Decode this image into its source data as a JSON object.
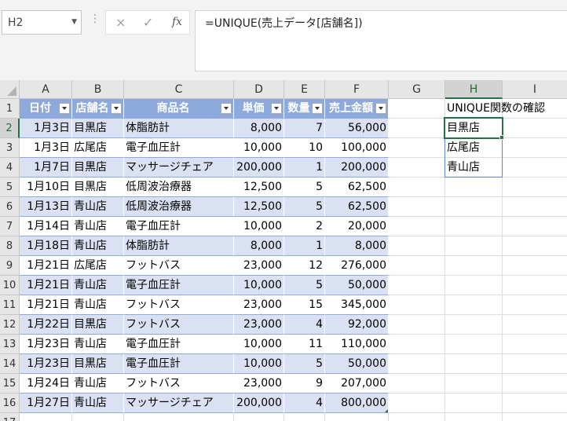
{
  "name_box": {
    "value": "H2"
  },
  "formula_bar": {
    "dots": "⋮",
    "cancel_icon": "×",
    "enter_icon": "✓",
    "fx_label": "fx",
    "formula": "=UNIQUE(売上データ[店舗名])"
  },
  "columns": [
    "A",
    "B",
    "C",
    "D",
    "E",
    "F",
    "G",
    "H",
    "I"
  ],
  "rows": [
    "1",
    "2",
    "3",
    "4",
    "5",
    "6",
    "7",
    "8",
    "9",
    "10",
    "11",
    "12",
    "13",
    "14",
    "15",
    "16",
    "17"
  ],
  "table": {
    "headers": [
      "日付",
      "店舗名",
      "商品名",
      "単価",
      "数量",
      "売上金額"
    ],
    "rows": [
      [
        "1月3日",
        "目黒店",
        "体脂肪計",
        "8,000",
        "7",
        "56,000"
      ],
      [
        "1月3日",
        "広尾店",
        "電子血圧計",
        "10,000",
        "10",
        "100,000"
      ],
      [
        "1月7日",
        "目黒店",
        "マッサージチェア",
        "200,000",
        "1",
        "200,000"
      ],
      [
        "1月10日",
        "目黒店",
        "低周波治療器",
        "12,500",
        "5",
        "62,500"
      ],
      [
        "1月13日",
        "青山店",
        "低周波治療器",
        "12,500",
        "5",
        "62,500"
      ],
      [
        "1月14日",
        "青山店",
        "電子血圧計",
        "10,000",
        "2",
        "20,000"
      ],
      [
        "1月18日",
        "青山店",
        "体脂肪計",
        "8,000",
        "1",
        "8,000"
      ],
      [
        "1月21日",
        "広尾店",
        "フットバス",
        "23,000",
        "12",
        "276,000"
      ],
      [
        "1月21日",
        "青山店",
        "電子血圧計",
        "10,000",
        "5",
        "50,000"
      ],
      [
        "1月21日",
        "青山店",
        "フットバス",
        "23,000",
        "15",
        "345,000"
      ],
      [
        "1月22日",
        "目黒店",
        "フットバス",
        "23,000",
        "4",
        "92,000"
      ],
      [
        "1月23日",
        "青山店",
        "電子血圧計",
        "10,000",
        "11",
        "110,000"
      ],
      [
        "1月23日",
        "目黒店",
        "電子血圧計",
        "10,000",
        "5",
        "50,000"
      ],
      [
        "1月24日",
        "青山店",
        "フットバス",
        "23,000",
        "9",
        "207,000"
      ],
      [
        "1月27日",
        "青山店",
        "マッサージチェア",
        "200,000",
        "4",
        "800,000"
      ]
    ]
  },
  "unique_check": {
    "label": "UNIQUE関数の確認",
    "results": [
      "目黒店",
      "広尾店",
      "青山店"
    ]
  },
  "colors": {
    "table_header": "#8ea9db",
    "table_band": "#d9e1f2",
    "selection": "#217346",
    "spill": "#5b86d3"
  }
}
